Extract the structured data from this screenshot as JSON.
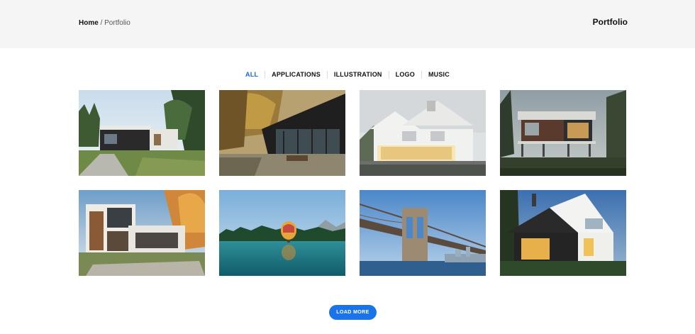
{
  "breadcrumb": {
    "home": "Home",
    "separator": " / ",
    "current": "Portfolio"
  },
  "page_title": "Portfolio",
  "filters": [
    "ALL",
    "APPLICATIONS",
    "ILLUSTRATION",
    "LOGO",
    "MUSIC"
  ],
  "active_filter": "ALL",
  "accent_color": "#1d63e6",
  "portfolio_items": [
    {
      "name": "modern-house-forest"
    },
    {
      "name": "dark-wood-house-autumn"
    },
    {
      "name": "white-house-glass"
    },
    {
      "name": "modern-house-stilts"
    },
    {
      "name": "modern-house-autumn-trees"
    },
    {
      "name": "hot-air-balloon-lake"
    },
    {
      "name": "suspension-bridge"
    },
    {
      "name": "white-house-dusk"
    }
  ],
  "load_more_label": "LOAD MORE"
}
